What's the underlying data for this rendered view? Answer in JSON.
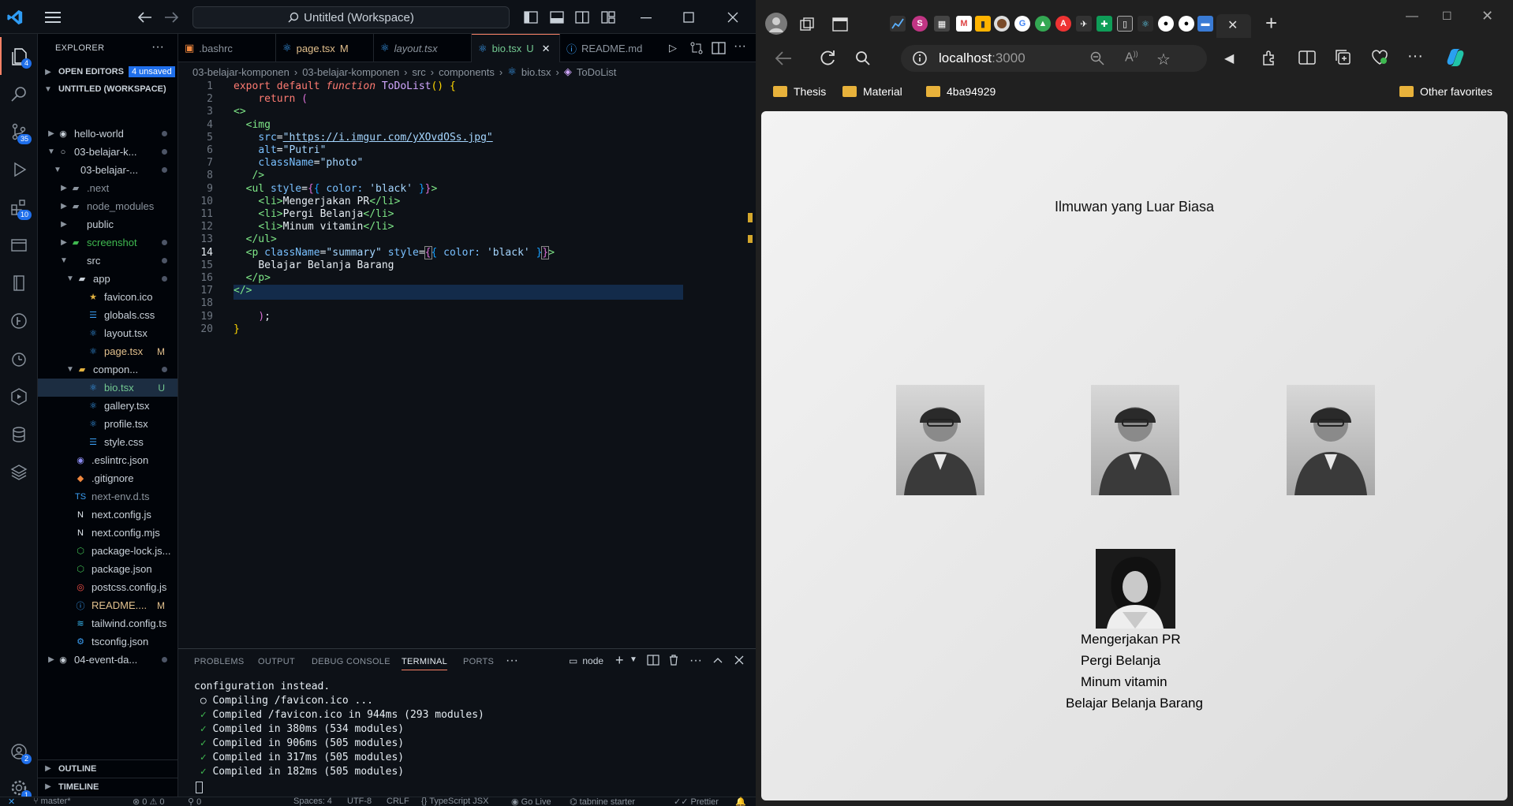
{
  "vscode": {
    "command_center": "Untitled (Workspace)",
    "activity_badges": {
      "explorer": "4",
      "source_control": "35",
      "extensions": "10",
      "accounts": "2",
      "manage": "1"
    },
    "sidebar": {
      "title": "EXPLORER",
      "open_editors": "OPEN EDITORS",
      "unsaved": "4 unsaved",
      "workspace": "UNTITLED (WORKSPACE)",
      "outline": "OUTLINE",
      "timeline": "TIMELINE",
      "tree": [
        {
          "label": "hello-world",
          "mark": ""
        },
        {
          "label": "03-belajar-k...",
          "mark": ""
        },
        {
          "label": "03-belajar-...",
          "mark": ""
        },
        {
          "label": ".next",
          "mark": ""
        },
        {
          "label": "node_modules",
          "mark": ""
        },
        {
          "label": "public",
          "mark": ""
        },
        {
          "label": "screenshot",
          "mark": ""
        },
        {
          "label": "src",
          "mark": ""
        },
        {
          "label": "app",
          "mark": ""
        },
        {
          "label": "favicon.ico",
          "mark": ""
        },
        {
          "label": "globals.css",
          "mark": ""
        },
        {
          "label": "layout.tsx",
          "mark": ""
        },
        {
          "label": "page.tsx",
          "mark": "M"
        },
        {
          "label": "compon...",
          "mark": ""
        },
        {
          "label": "bio.tsx",
          "mark": "U"
        },
        {
          "label": "gallery.tsx",
          "mark": ""
        },
        {
          "label": "profile.tsx",
          "mark": ""
        },
        {
          "label": "style.css",
          "mark": ""
        },
        {
          "label": ".eslintrc.json",
          "mark": ""
        },
        {
          "label": ".gitignore",
          "mark": ""
        },
        {
          "label": "next-env.d.ts",
          "mark": ""
        },
        {
          "label": "next.config.js",
          "mark": ""
        },
        {
          "label": "next.config.mjs",
          "mark": ""
        },
        {
          "label": "package-lock.js...",
          "mark": ""
        },
        {
          "label": "package.json",
          "mark": ""
        },
        {
          "label": "postcss.config.js",
          "mark": ""
        },
        {
          "label": "README....",
          "mark": "M"
        },
        {
          "label": "tailwind.config.ts",
          "mark": ""
        },
        {
          "label": "tsconfig.json",
          "mark": ""
        },
        {
          "label": "04-event-da...",
          "mark": ""
        }
      ]
    },
    "tabs": [
      {
        "label": ".bashrc",
        "mark": ""
      },
      {
        "label": "page.tsx",
        "mark": "M"
      },
      {
        "label": "layout.tsx",
        "mark": ""
      },
      {
        "label": "bio.tsx",
        "mark": "U"
      },
      {
        "label": "README.md",
        "mark": ""
      }
    ],
    "breadcrumb": [
      "03-belajar-komponen",
      "03-belajar-komponen",
      "src",
      "components",
      "bio.tsx",
      "ToDoList"
    ],
    "code_lines": [
      "1",
      "2",
      "3",
      "4",
      "5",
      "6",
      "7",
      "8",
      "9",
      "10",
      "11",
      "12",
      "13",
      "14",
      "15",
      "16",
      "17",
      "18",
      "19",
      "20"
    ],
    "code": {
      "kw_export": "export default",
      "kw_function": "function",
      "fn_name": "ToDoList",
      "kw_return": "return",
      "img_src": "\"https://i.imgur.com/yXOvdOSs.jpg\"",
      "img_alt": "\"Putri\"",
      "img_class": "\"photo\"",
      "color_black": "'black'",
      "li1": "Mengerjakan PR",
      "li2": "Pergi Belanja",
      "li3": "Minum vitamin",
      "p_class": "\"summary\"",
      "p_text": "Belajar Belanja Barang"
    },
    "panel": {
      "tabs": [
        "PROBLEMS",
        "OUTPUT",
        "DEBUG CONSOLE",
        "TERMINAL",
        "PORTS"
      ],
      "terminal_name": "node",
      "lines": [
        "configuration instead.",
        "Compiling /favicon.ico ...",
        "Compiled /favicon.ico in 944ms (293 modules)",
        "Compiled in 380ms (534 modules)",
        "Compiled in 906ms (505 modules)",
        "Compiled in 317ms (505 modules)",
        "Compiled in 182ms (505 modules)"
      ]
    },
    "status": {
      "branch": "master*",
      "errors": "0",
      "warnings": "0",
      "ports": "0",
      "spaces": "Spaces: 4",
      "encoding": "UTF-8",
      "eol": "CRLF",
      "language": "{} TypeScript JSX",
      "golive": "Go Live",
      "tabnine": "tabnine starter",
      "prettier": "Prettier"
    }
  },
  "browser": {
    "url_host": "localhost",
    "url_port": ":3000",
    "favorites": [
      "Thesis",
      "Material",
      "4ba94929"
    ],
    "other_favorites": "Other favorites",
    "page": {
      "heading": "Ilmuwan yang Luar Biasa",
      "list": [
        "Mengerjakan PR",
        "Pergi Belanja",
        "Minum vitamin"
      ],
      "summary": "Belajar Belanja Barang"
    }
  }
}
